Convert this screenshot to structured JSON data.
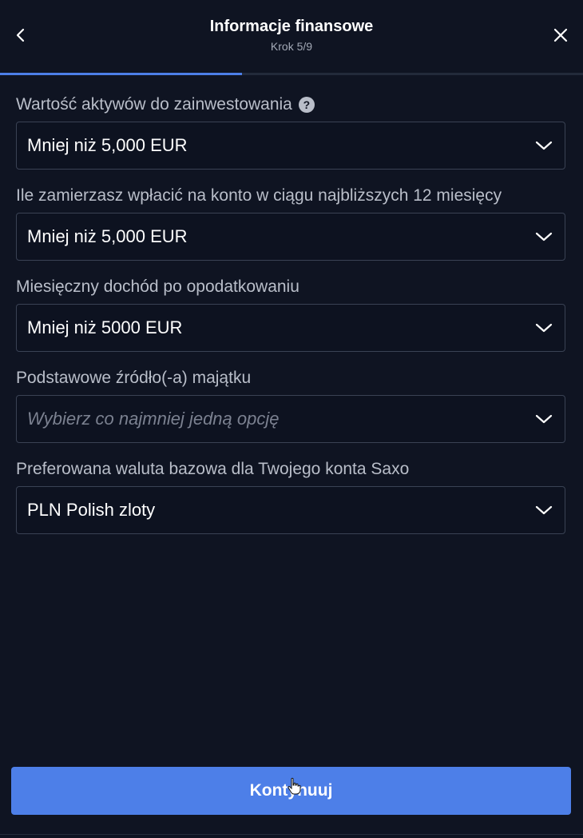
{
  "header": {
    "title": "Informacje finansowe",
    "step": "Krok 5/9",
    "back_icon": "chevron-left-icon",
    "close_icon": "close-icon"
  },
  "progress": {
    "fraction": 0.4157,
    "color": "#4c7fe8"
  },
  "form": {
    "fields": [
      {
        "label": "Wartość aktywów do zainwestowania",
        "value": "Mniej niż 5,000 EUR",
        "has_help": true
      },
      {
        "label": "Ile zamierzasz wpłacić na konto w ciągu najbliższych 12 miesięcy",
        "value": "Mniej niż 5,000 EUR"
      },
      {
        "label": "Miesięczny dochód po opodatkowaniu",
        "value": "Mniej niż 5000 EUR"
      },
      {
        "label": "Podstawowe źródło(-a) majątku",
        "placeholder": "Wybierz co najmniej jedną opcję"
      },
      {
        "label": "Preferowana waluta bazowa dla Twojego konta Saxo",
        "value": "PLN Polish zloty"
      }
    ],
    "help_icon_text": "?"
  },
  "continue_button": {
    "label": "Kontynuuj",
    "color": "#4d7fe8"
  },
  "colors": {
    "background": "#0f1422",
    "accent": "#4c7fe8"
  }
}
